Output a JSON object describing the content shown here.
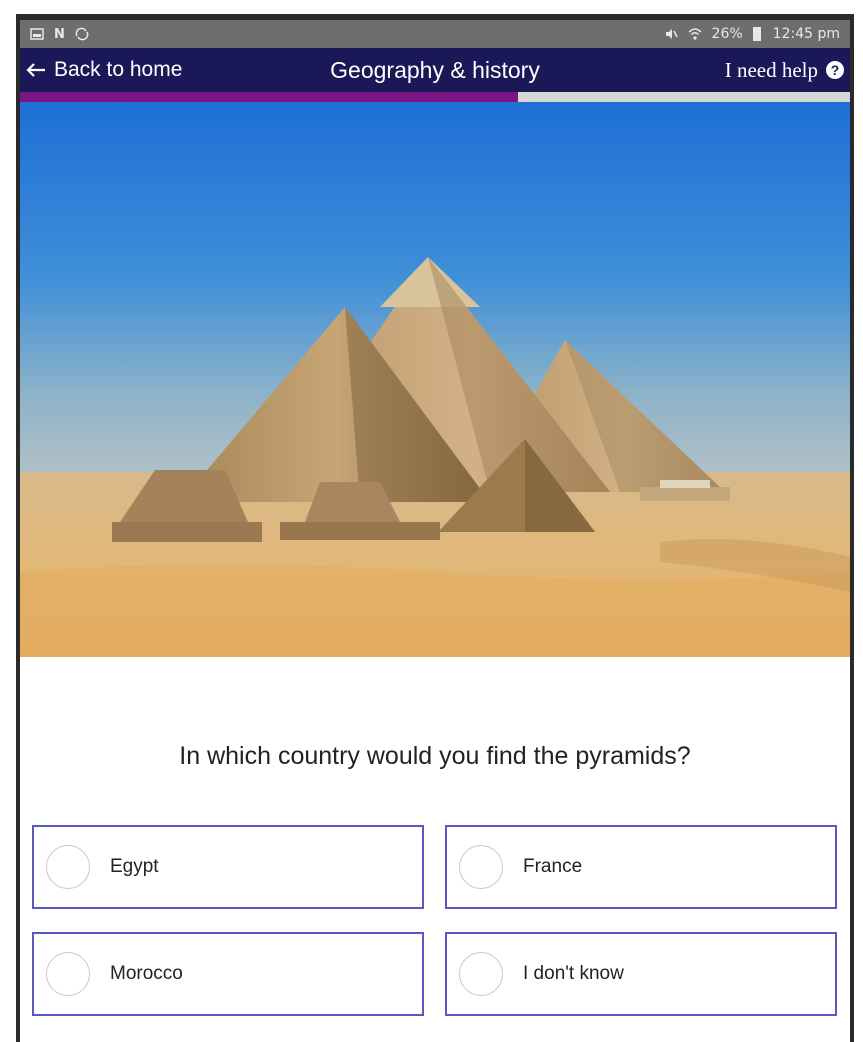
{
  "status_bar": {
    "left_icons": [
      "gallery-icon",
      "nfc-icon",
      "sync-icon"
    ],
    "left_glyph_n": "N",
    "right_icons": [
      "mute-icon",
      "wifi-icon",
      "battery-icon"
    ],
    "battery": "26%",
    "time": "12:45 pm"
  },
  "header": {
    "back_label": "Back to home",
    "title": "Geography & history",
    "help_label": "I need help",
    "help_badge": "?"
  },
  "progress": {
    "fraction": 0.6,
    "fill_color": "#7a1586",
    "track_color": "#d7d7d7"
  },
  "colors": {
    "header_bg": "#1b1858",
    "option_border": "#5a58c6"
  },
  "question": {
    "text": "In which country would you find the pyramids?"
  },
  "options": [
    {
      "label": "Egypt"
    },
    {
      "label": "France"
    },
    {
      "label": "Morocco"
    },
    {
      "label": "I don't know"
    }
  ]
}
